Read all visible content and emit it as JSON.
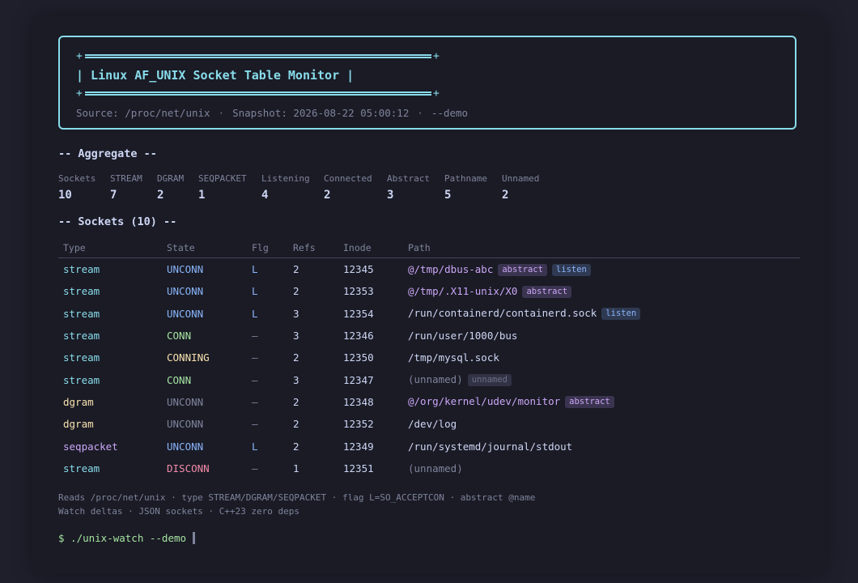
{
  "header": {
    "title": "| Linux AF_UNIX Socket Table Monitor |",
    "source": "Source: /proc/net/unix",
    "snapshot": "Snapshot: 2026-08-22 05:00:12",
    "mode": "--demo",
    "separator": "·",
    "plus": "+"
  },
  "aggregate": {
    "title": "-- Aggregate --",
    "items": [
      {
        "label": "Sockets",
        "value": "10"
      },
      {
        "label": "STREAM",
        "value": "7"
      },
      {
        "label": "DGRAM",
        "value": "2"
      },
      {
        "label": "SEQPACKET",
        "value": "1"
      },
      {
        "label": "Listening",
        "value": "4"
      },
      {
        "label": "Connected",
        "value": "2"
      },
      {
        "label": "Abstract",
        "value": "3"
      },
      {
        "label": "Pathname",
        "value": "5"
      },
      {
        "label": "Unnamed",
        "value": "2"
      }
    ]
  },
  "sockets": {
    "title": "-- Sockets (10) --",
    "columns": [
      "Type",
      "State",
      "Flg",
      "Refs",
      "Inode",
      "Path"
    ],
    "rows": [
      {
        "type": "stream",
        "state": "UNCONN",
        "flg": "L",
        "refs": "2",
        "inode": "12345",
        "path": "@/tmp/dbus-abc",
        "kind": "abstract",
        "tags": [
          "abstract",
          "listen"
        ]
      },
      {
        "type": "stream",
        "state": "UNCONN",
        "flg": "L",
        "refs": "2",
        "inode": "12353",
        "path": "@/tmp/.X11-unix/X0",
        "kind": "abstract",
        "tags": [
          "abstract"
        ]
      },
      {
        "type": "stream",
        "state": "UNCONN",
        "flg": "L",
        "refs": "3",
        "inode": "12354",
        "path": "/run/containerd/containerd.sock",
        "kind": "path",
        "tags": [
          "listen"
        ]
      },
      {
        "type": "stream",
        "state": "CONN",
        "flg": "–",
        "refs": "3",
        "inode": "12346",
        "path": "/run/user/1000/bus",
        "kind": "path",
        "tags": []
      },
      {
        "type": "stream",
        "state": "CONNING",
        "flg": "–",
        "refs": "2",
        "inode": "12350",
        "path": "/tmp/mysql.sock",
        "kind": "path",
        "tags": []
      },
      {
        "type": "stream",
        "state": "CONN",
        "flg": "–",
        "refs": "3",
        "inode": "12347",
        "path": "(unnamed)",
        "kind": "unnamed",
        "tags": [
          "unnamed"
        ]
      },
      {
        "type": "dgram",
        "state": "UNCONN",
        "flg": "–",
        "refs": "2",
        "inode": "12348",
        "path": "@/org/kernel/udev/monitor",
        "kind": "abstract",
        "tags": [
          "abstract"
        ]
      },
      {
        "type": "dgram",
        "state": "UNCONN",
        "flg": "–",
        "refs": "2",
        "inode": "12352",
        "path": "/dev/log",
        "kind": "path",
        "tags": []
      },
      {
        "type": "seqpacket",
        "state": "UNCONN",
        "flg": "L",
        "refs": "2",
        "inode": "12349",
        "path": "/run/systemd/journal/stdout",
        "kind": "path",
        "tags": []
      },
      {
        "type": "stream",
        "state": "DISCONN",
        "flg": "–",
        "refs": "1",
        "inode": "12351",
        "path": "(unnamed)",
        "kind": "unnamed",
        "tags": []
      }
    ]
  },
  "footer": {
    "line1": "Reads /proc/net/unix · type STREAM/DGRAM/SEQPACKET · flag L=SO_ACCEPTCON · abstract @name",
    "line2": "Watch deltas · JSON sockets · C++23 zero deps",
    "prompt": "$ ./unix-watch --demo"
  }
}
